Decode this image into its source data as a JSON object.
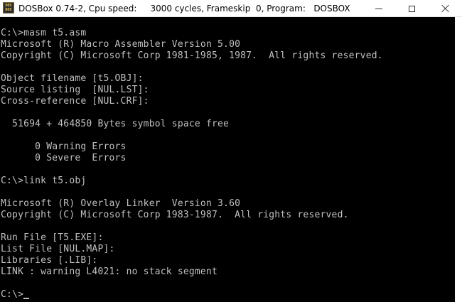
{
  "window": {
    "title": "DOSBox 0.74-2, Cpu speed:     3000 cycles, Frameskip  0, Program:   DOSBOX",
    "icon": "dosbox-icon",
    "icon_text": "DOS BOX"
  },
  "controls": {
    "minimize": "minimize-icon",
    "maximize": "maximize-icon",
    "close": "close-icon"
  },
  "console": {
    "text_color": "#c0c0c0",
    "background": "#000000",
    "lines": [
      "C:\\>masm t5.asm",
      "Microsoft (R) Macro Assembler Version 5.00",
      "Copyright (C) Microsoft Corp 1981-1985, 1987.  All rights reserved.",
      "",
      "Object filename [t5.OBJ]:",
      "Source listing  [NUL.LST]:",
      "Cross-reference [NUL.CRF]:",
      "",
      "  51694 + 464850 Bytes symbol space free",
      "",
      "      0 Warning Errors",
      "      0 Severe  Errors",
      "",
      "C:\\>link t5.obj",
      "",
      "Microsoft (R) Overlay Linker  Version 3.60",
      "Copyright (C) Microsoft Corp 1983-1987.  All rights reserved.",
      "",
      "Run File [T5.EXE]:",
      "List File [NUL.MAP]:",
      "Libraries [.LIB]:",
      "LINK : warning L4021: no stack segment",
      "",
      "C:\\>"
    ]
  }
}
